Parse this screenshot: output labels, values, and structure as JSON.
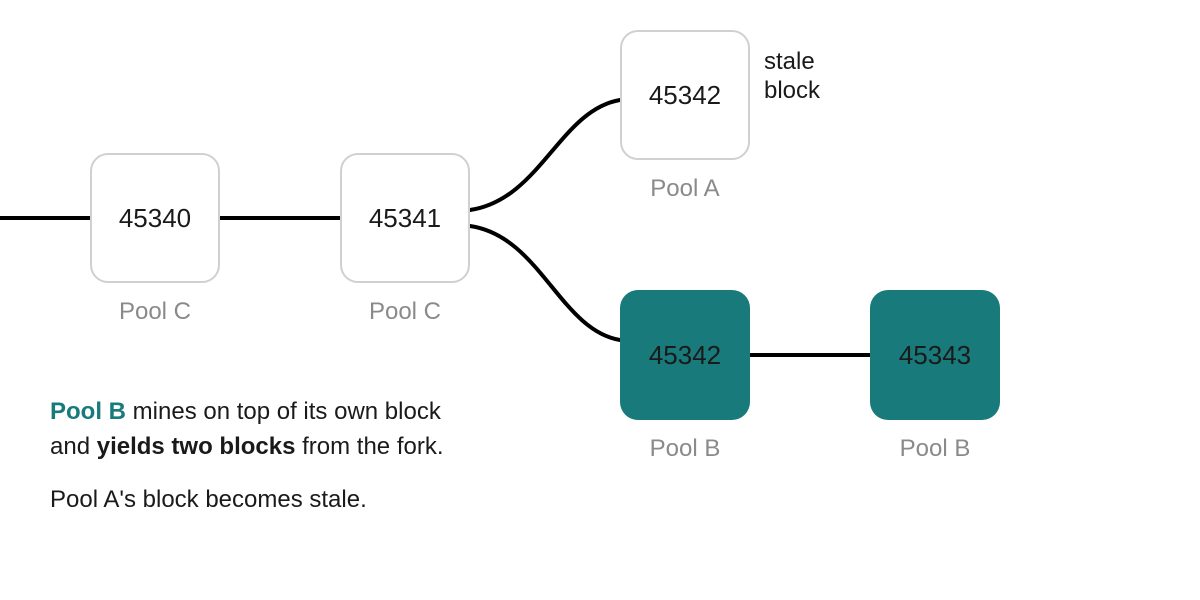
{
  "blocks": {
    "b1": {
      "height": "45340",
      "pool": "Pool C"
    },
    "b2": {
      "height": "45341",
      "pool": "Pool C"
    },
    "b3": {
      "height": "45342",
      "pool": "Pool A"
    },
    "b4": {
      "height": "45342",
      "pool": "Pool B"
    },
    "b5": {
      "height": "45343",
      "pool": "Pool B"
    }
  },
  "side_label": {
    "line1": "stale",
    "line2": "block"
  },
  "caption": {
    "teal": "Pool B",
    "seg1": " mines on top of its own block",
    "seg2": "and ",
    "bold": "yields two blocks",
    "seg3": " from the fork.",
    "line2": "Pool A's block becomes stale."
  },
  "colors": {
    "teal": "#187a7a",
    "border": "#d0d0d0",
    "text": "#1a1a1a",
    "muted": "#8a8a8a",
    "wire": "#000000"
  }
}
